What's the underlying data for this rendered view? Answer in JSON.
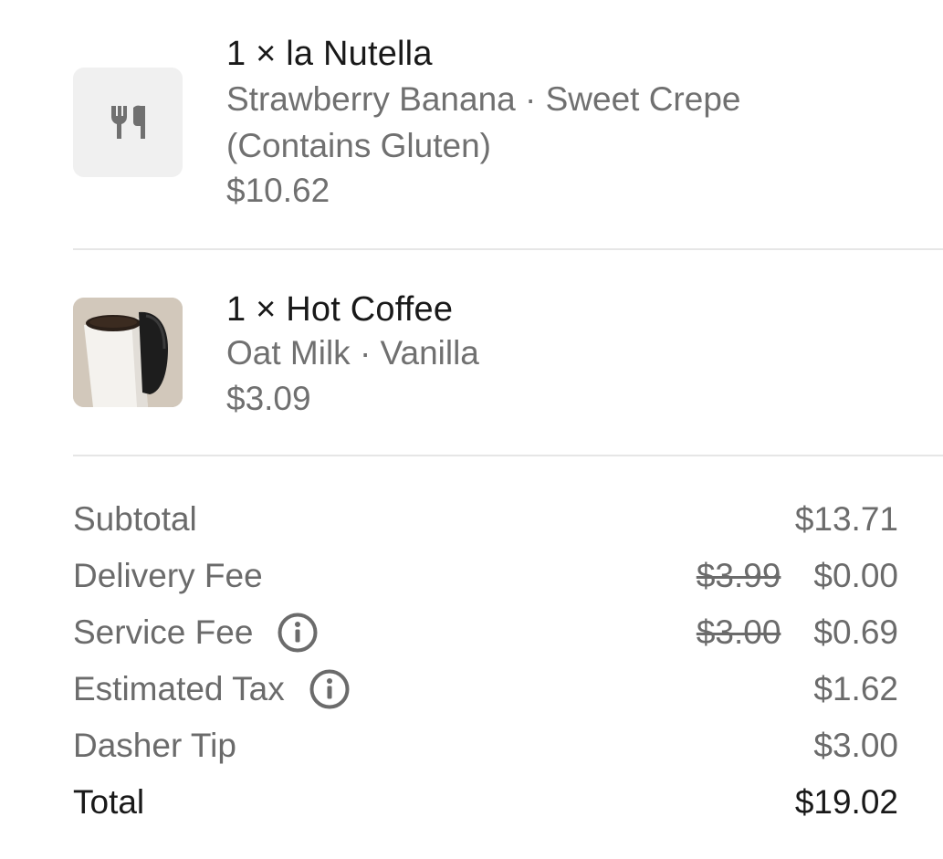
{
  "items": [
    {
      "title": "1 × la Nutella",
      "options_line1": "Strawberry Banana · Sweet Crepe",
      "options_line2": "(Contains Gluten)",
      "price": "$10.62",
      "icon": "fork-knife-icon"
    },
    {
      "title": "1 × Hot Coffee",
      "options_line1": "Oat Milk · Vanilla",
      "price": "$3.09",
      "icon": "coffee-cup-photo"
    }
  ],
  "summary": {
    "subtotal": {
      "label": "Subtotal",
      "value": "$13.71"
    },
    "delivery_fee": {
      "label": "Delivery Fee",
      "original": "$3.99",
      "value": "$0.00"
    },
    "service_fee": {
      "label": "Service Fee",
      "original": "$3.00",
      "value": "$0.69",
      "icon": "info-icon"
    },
    "estimated_tax": {
      "label": "Estimated Tax",
      "value": "$1.62",
      "icon": "info-icon"
    },
    "dasher_tip": {
      "label": "Dasher Tip",
      "value": "$3.00"
    },
    "total": {
      "label": "Total",
      "value": "$19.02"
    }
  },
  "colors": {
    "primary_text": "#191919",
    "secondary_text": "#707070",
    "divider": "#e6e6e6",
    "thumb_bg": "#f0f0f0"
  }
}
